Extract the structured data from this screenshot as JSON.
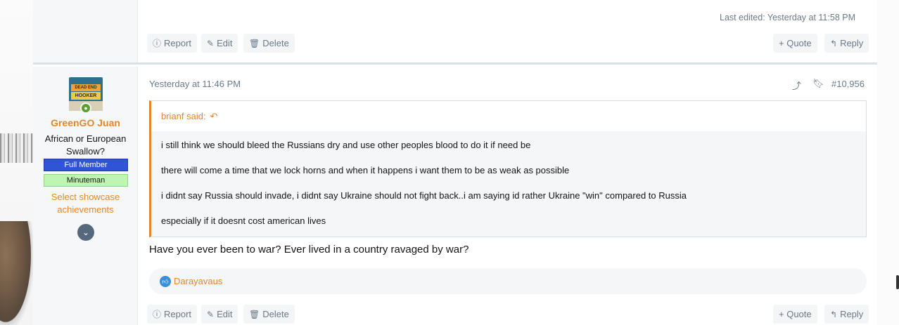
{
  "previous_post": {
    "last_edited": "Last edited: Yesterday at 11:58 PM",
    "actions": {
      "report": "Report",
      "edit": "Edit",
      "delete": "Delete",
      "quote": "+ Quote",
      "reply": "Reply"
    }
  },
  "post": {
    "timestamp": "Yesterday at 11:46 PM",
    "post_number": "#10,956",
    "user": {
      "username": "GreenGO Juan",
      "title": "African or European Swallow?",
      "banners": [
        "Full Member",
        "Minuteman"
      ],
      "showcase_link": "Select showcase achievements",
      "avatar_text_top": "DEAD END",
      "avatar_text_bottom": "HOOKER"
    },
    "quote": {
      "author": "brianf said:",
      "lines": [
        "i still think we should bleed the Russians dry and use other peoples blood to do it if need be",
        "there will come a time that we lock horns and when it happens i want them to be as weak as possible",
        "i didnt say Russia should invade, i didnt say Ukraine should not fight back..i am saying id rather Ukraine \"win\" compared to Russia",
        "especially if it doesnt cost american lives"
      ]
    },
    "body": "Have you ever been to war? Ever lived in a country ravaged by war?",
    "reactions": {
      "users": "Darayavaus"
    },
    "actions": {
      "report": "Report",
      "edit": "Edit",
      "delete": "Delete",
      "quote": "+ Quote",
      "reply": "Reply"
    }
  },
  "icons": {
    "report": "report-icon",
    "edit": "edit-icon",
    "delete": "trash-icon",
    "reply": "reply-icon",
    "share": "share-icon",
    "bookmark": "bookmark-icon",
    "expand": "chevron-down-icon",
    "like": "like-icon",
    "return": "return-arrow-icon"
  },
  "colors": {
    "accent": "#e0892b",
    "muted": "#6b7a88",
    "full_member_banner": "#2f54d6",
    "minuteman_banner": "#bff5b3",
    "online": "#5aa02c",
    "like": "#3b8ed8"
  }
}
